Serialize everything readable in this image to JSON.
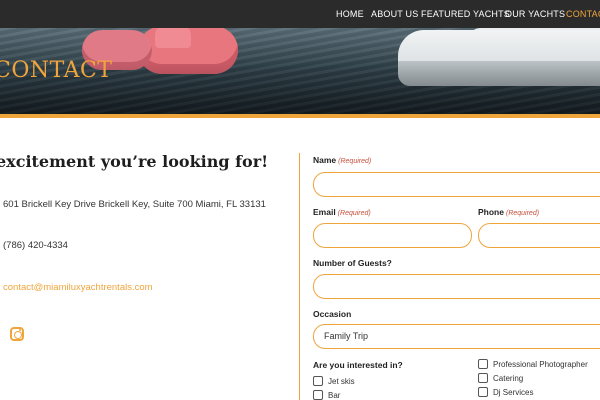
{
  "nav": {
    "items": [
      {
        "label": "HOME",
        "active": false
      },
      {
        "label": "ABOUT US",
        "active": false
      },
      {
        "label": "FEATURED YACHTS",
        "active": false
      },
      {
        "label": "OUR YACHTS",
        "active": false
      },
      {
        "label": "CONTACT",
        "active": true
      }
    ]
  },
  "hero": {
    "title": "CONTACT"
  },
  "left": {
    "heading": "excitement you’re looking for!",
    "address": "601 Brickell Key Drive Brickell Key, Suite 700 Miami, FL 33131",
    "phone": "(786) 420-4334",
    "email": "contact@miamiluxyachtrentals.com",
    "social_icon": "instagram-icon"
  },
  "form": {
    "required_text": "(Required)",
    "name_label": "Name",
    "email_label": "Email",
    "phone_label": "Phone",
    "guests_label": "Number of Guests?",
    "occasion_label": "Occasion",
    "occasion_value": "Family Trip",
    "interest_label": "Are you interested in?",
    "interests_col1": [
      "Jet skis",
      "Bar"
    ],
    "interests_col2": [
      "Professional Photographer",
      "Catering",
      "Dj Services"
    ]
  },
  "colors": {
    "accent": "#f0a53c",
    "navbar": "#2b2b2b",
    "required": "#c6503a"
  }
}
